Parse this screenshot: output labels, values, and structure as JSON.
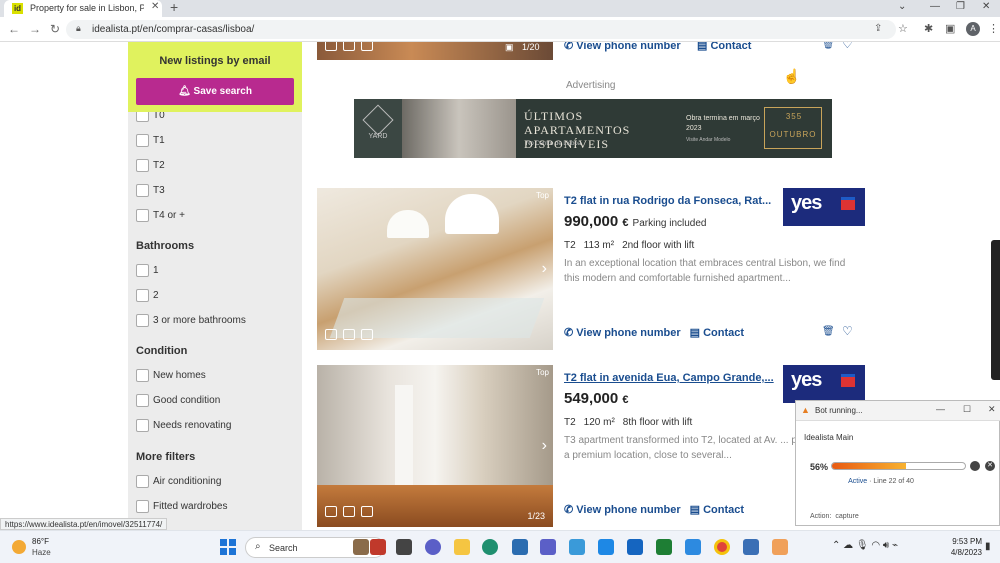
{
  "browser": {
    "tab_title": "Property for sale in Lisbon, Portu",
    "tab_favicon": "id",
    "new_tab": "+",
    "url": "idealista.pt/en/comprar-casas/lisboa/",
    "avatar": "A",
    "status_url": "https://www.idealista.pt/en/imovel/32511774/"
  },
  "sidebar": {
    "alert_heading": "New listings by email",
    "save_search": "Save search",
    "bedrooms": [
      "T0",
      "T1",
      "T2",
      "T3",
      "T4 or +"
    ],
    "bathrooms_heading": "Bathrooms",
    "bathrooms": [
      "1",
      "2",
      "3 or more bathrooms"
    ],
    "condition_heading": "Condition",
    "condition": [
      "New homes",
      "Good condition",
      "Needs renovating"
    ],
    "more_filters_heading": "More filters",
    "more_filters": [
      "Air conditioning",
      "Fitted wardrobes"
    ]
  },
  "top_card": {
    "photo_count": "1/20",
    "view_phone": "View phone number",
    "contact": "Contact"
  },
  "ad": {
    "label": "Advertising",
    "logo": "YARD",
    "headline": "ÚLTIMOS APARTAMENTOS DISPONÍVEIS",
    "sub": "No Centro de Lisboa",
    "works": "Obra termina em março 2023",
    "visit": "Visite Andar Modelo",
    "brand_number": "355",
    "brand_name": "OUTUBRO"
  },
  "listings": [
    {
      "tag": "Top",
      "title": "T2 flat in rua Rodrigo da Fonseca, Rat...",
      "price": "990,000",
      "currency": "€",
      "extra": "Parking included",
      "typology": "T2",
      "area": "113 m²",
      "floor": "2nd floor with lift",
      "description": "In an exceptional location that embraces central Lisbon, we find this modern and comfortable furnished apartment...",
      "view_phone": "View phone number",
      "contact": "Contact",
      "agency": "yes"
    },
    {
      "tag": "Top",
      "title": "T2 flat in avenida Eua, Campo Grande,...",
      "price": "549,000",
      "currency": "€",
      "extra": "",
      "typology": "T2",
      "area": "120 m²",
      "floor": "8th floor with lift",
      "description": "T3 apartment transformed into T2, located at Av. ... property has a premium location, close to several...",
      "view_phone": "View phone number",
      "contact": "Contact",
      "agency": "yes",
      "photo_count": "1/23"
    }
  ],
  "bot": {
    "title": "Bot running...",
    "name": "Idealista Main",
    "percent_label": "56%",
    "percent": 56,
    "status": "Active",
    "line": "Line 22 of 40",
    "action_label": "Action:",
    "action": "capture"
  },
  "taskbar": {
    "temp": "86°F",
    "condition": "Haze",
    "search_placeholder": "Search",
    "time": "9:53 PM",
    "date": "4/8/2023"
  },
  "colors": {
    "brand_link": "#1a4d8f",
    "save_button": "#b82a8f",
    "alert_bg": "#e0f25e",
    "agency_bg": "#1c2b7c"
  }
}
